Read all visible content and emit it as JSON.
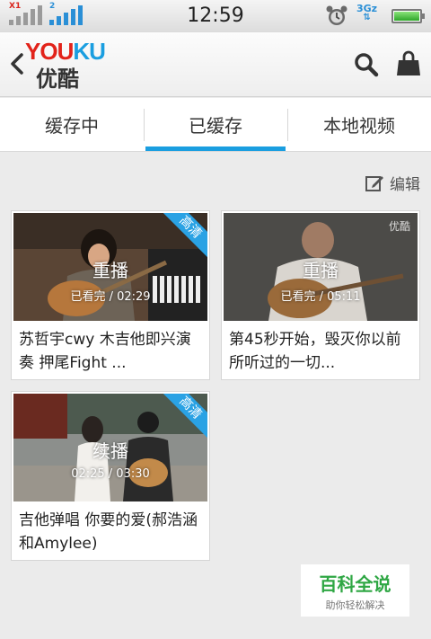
{
  "status_bar": {
    "sim1_tag": "X1",
    "sim2_tag": "2",
    "time": "12:59",
    "network": "3Gz"
  },
  "header": {
    "logo_en_you": "YOU",
    "logo_en_ku": "KU",
    "logo_cn": "优酷",
    "icons": [
      "back-arrow-icon",
      "search-icon",
      "shopping-bag-icon"
    ]
  },
  "tabs": [
    {
      "label": "缓存中"
    },
    {
      "label": "已缓存"
    },
    {
      "label": "本地视频"
    }
  ],
  "edit_label": "编辑",
  "videos": [
    {
      "play_label": "重播",
      "progress": "已看完 / 02:29",
      "hd_label": "高清",
      "title": "苏哲宇cwy 木吉他即兴演奏 押尾Fight ..."
    },
    {
      "play_label": "重播",
      "progress": "已看完 / 05:11",
      "watermark": "优酷",
      "title": "第45秒开始，毁灭你以前所听过的一切..."
    },
    {
      "play_label": "续播",
      "progress": "02:25 / 03:30",
      "hd_label": "高清",
      "title": "吉他弹唱 你要的爱(郝浩涵和Amylee)"
    }
  ],
  "badge": {
    "title": "百科全说",
    "subtitle": "助你轻松解决"
  },
  "colors": {
    "accent": "#1a9ee0",
    "logo_red": "#e2231a",
    "hd_ribbon": "#2aa2e4"
  }
}
